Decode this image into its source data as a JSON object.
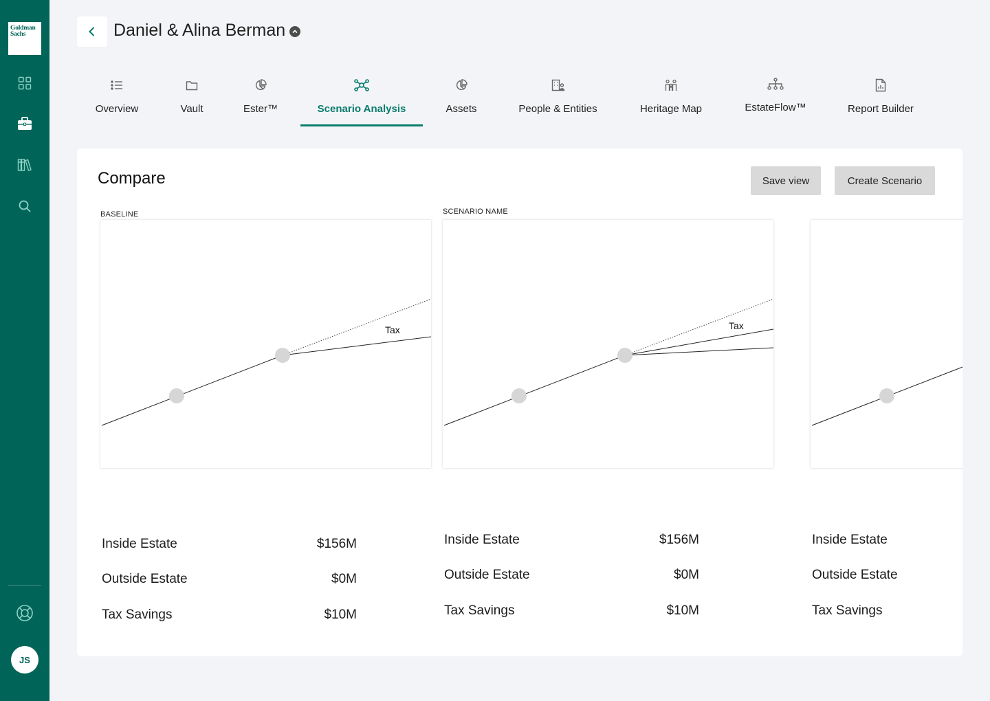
{
  "brand": {
    "logo_line1": "Goldman",
    "logo_line2": "Sachs"
  },
  "sidebar": {
    "icons": [
      "dashboard-grid-icon",
      "briefcase-icon",
      "library-icon",
      "search-icon"
    ],
    "footer_icons": [
      "help-lifebuoy-icon"
    ],
    "user_initials": "JS"
  },
  "header": {
    "client_name": "Daniel & Alina Berman"
  },
  "tabs": [
    {
      "label": "Overview",
      "icon": "list-icon"
    },
    {
      "label": "Vault",
      "icon": "folder-icon"
    },
    {
      "label": "Ester™",
      "icon": "pie-chart-icon"
    },
    {
      "label": "Scenario Analysis",
      "icon": "network-icon",
      "active": true
    },
    {
      "label": "Assets",
      "icon": "pie-chart-icon"
    },
    {
      "label": "People & Entities",
      "icon": "building-person-icon"
    },
    {
      "label": "Heritage Map",
      "icon": "family-icon"
    },
    {
      "label": "EstateFlow™",
      "icon": "hierarchy-icon"
    },
    {
      "label": "Report Builder",
      "icon": "report-icon"
    }
  ],
  "compare": {
    "title": "Compare",
    "save_label": "Save view",
    "create_label": "Create Scenario",
    "accent_color": "#006558",
    "panels": [
      {
        "label": "BASELINE",
        "annotation": "Tax",
        "stats": [
          {
            "label": "Inside Estate",
            "value": "$156M"
          },
          {
            "label": "Outside Estate",
            "value": "$0M"
          },
          {
            "label": "Tax Savings",
            "value": "$10M"
          }
        ]
      },
      {
        "label": "SCENARIO NAME",
        "annotation": "Tax",
        "stats": [
          {
            "label": "Inside Estate",
            "value": "$156M"
          },
          {
            "label": "Outside Estate",
            "value": "$0M"
          },
          {
            "label": "Tax Savings",
            "value": "$10M"
          }
        ]
      },
      {
        "label": "",
        "annotation": "",
        "stats": [
          {
            "label": "Inside Estate",
            "value": ""
          },
          {
            "label": "Outside Estate",
            "value": ""
          },
          {
            "label": "Tax Savings",
            "value": ""
          }
        ]
      }
    ]
  }
}
